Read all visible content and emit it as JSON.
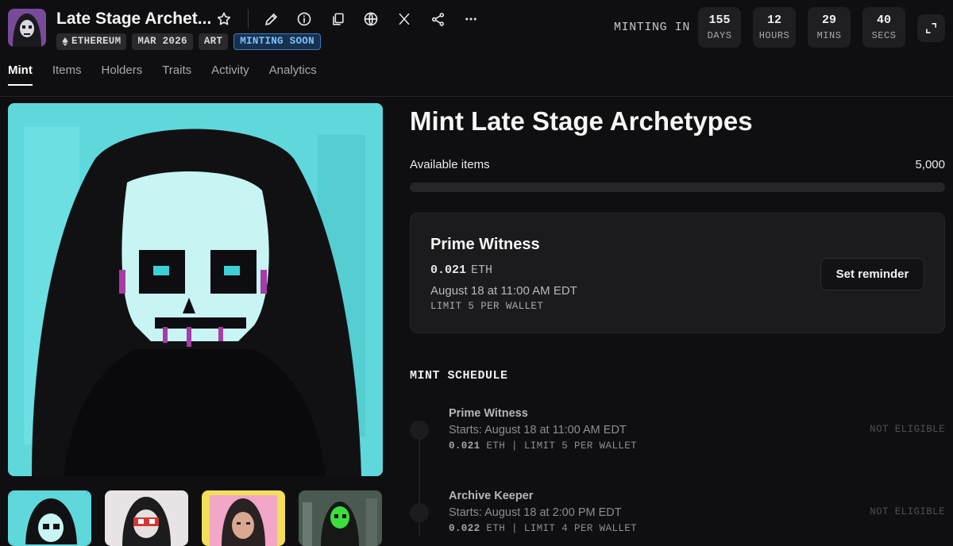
{
  "collection": {
    "title": "Late Stage Archet...",
    "tags": [
      "ETHEREUM",
      "MAR 2026",
      "ART"
    ],
    "status_tag": "MINTING SOON"
  },
  "toolbar_icons": [
    "star-icon",
    "pencil-icon",
    "info-icon",
    "copy-icon",
    "globe-icon",
    "x-icon",
    "share-icon",
    "more-icon"
  ],
  "countdown": {
    "label": "MINTING IN",
    "days": "155",
    "days_unit": "DAYS",
    "hours": "12",
    "hours_unit": "HOURS",
    "mins": "29",
    "mins_unit": "MINS",
    "secs": "40",
    "secs_unit": "SECS"
  },
  "tabs": [
    "Mint",
    "Items",
    "Holders",
    "Traits",
    "Activity",
    "Analytics"
  ],
  "active_tab": "Mint",
  "mint": {
    "title": "Mint Late Stage Archetypes",
    "available_label": "Available items",
    "available_value": "5,000",
    "progress_fraction": 0
  },
  "current_phase": {
    "name": "Prime Witness",
    "price": "0.021",
    "currency": "ETH",
    "date": "August 18 at 11:00 AM EDT",
    "limit": "LIMIT 5 PER WALLET",
    "button": "Set reminder"
  },
  "schedule": {
    "title": "MINT SCHEDULE",
    "phases": [
      {
        "name": "Prime Witness",
        "starts": "Starts: August 18 at 11:00 AM EDT",
        "price": "0.021",
        "details": "ETH | LIMIT 5 PER WALLET",
        "status": "NOT ELIGIBLE"
      },
      {
        "name": "Archive Keeper",
        "starts": "Starts: August 18 at 2:00 PM EDT",
        "price": "0.022",
        "details": "ETH | LIMIT 4 PER WALLET",
        "status": "NOT ELIGIBLE"
      }
    ]
  },
  "colors": {
    "accent_blue": "#7ec2ff",
    "hero_bg": "#5fd8dc",
    "background": "#0f0f11"
  }
}
